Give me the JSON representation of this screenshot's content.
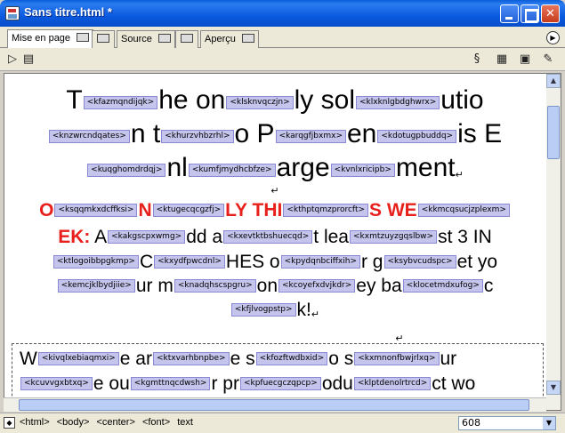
{
  "window": {
    "title": "Sans titre.html *"
  },
  "tabs": [
    {
      "label": "Mise en page",
      "active": true
    },
    {
      "label": ""
    },
    {
      "label": "Source"
    },
    {
      "label": ""
    },
    {
      "label": "Aperçu"
    }
  ],
  "toolbar": {
    "left_icons": [
      "play-arrow-icon",
      "document-icon"
    ],
    "right_icons": [
      "link-icon",
      "table-icon",
      "image-icon",
      "settings-icon"
    ]
  },
  "document": {
    "line1": {
      "t1": "T",
      "tag1": "<kfazmqndijqk>",
      "t2": "he on",
      "tag2": "<klsknvqczjn>",
      "t3": "ly sol",
      "tag3": "<klxknlgbdghwrx>",
      "t4": "utio"
    },
    "line2": {
      "tag1": "<knzwrcndqates>",
      "t1": "n t",
      "tag2": "<khurzvhbzrhl>",
      "t2": "o P",
      "tag3": "<karqgfjbxmx>",
      "t3": "en",
      "tag4": "<kdotugpbuddq>",
      "t4": "is E"
    },
    "line3": {
      "tag1": "<kuqghomdrdqj>",
      "t1": "nl",
      "tag2": "<kumfjmydhcbfze>",
      "t2": "arge",
      "tag3": "<kvnlxricipb>",
      "t3": "ment",
      "marker": "↵"
    },
    "marker2": "↵",
    "line4": {
      "t1": "O",
      "tag1": "<ksqqmkxdcffksi>",
      "t2": "N",
      "tag2": "<ktugecqcgzfj>",
      "t3": "LY THI",
      "tag3": "<kthptqmzprorcft>",
      "t4": "S WE",
      "tag4": "<kkmcqsucjzplexm>"
    },
    "line5": {
      "t1": "EK:",
      "t2": "A",
      "tag1": "<kakgscpxwmg>",
      "t3": "dd a",
      "tag2": "<kxevtktbshuecqd>",
      "t4": "t lea",
      "tag3": "<kxmtzuyzgqslbw>",
      "t5": "st 3 IN"
    },
    "line6": {
      "tag1": "<ktlogoibbpgkmp>",
      "t1": "C",
      "tag2": "<kxydfpwcdnl>",
      "t2": "HES o",
      "tag3": "<kpydqnbciffxih>",
      "t3": "r g",
      "tag4": "<ksybvcudspc>",
      "t4": "et yo"
    },
    "line7": {
      "tag1": "<kemcjklbydjiie>",
      "t1": "ur m",
      "tag2": "<knadqhscspgru>",
      "t2": "on",
      "tag3": "<kcoyefxdvjkdr>",
      "t3": "ey ba",
      "tag4": "<klocetmdxufog>",
      "t4": "c"
    },
    "line8": {
      "tag1": "<kfjlvogpstp>",
      "t1": "k!",
      "marker": "↵"
    },
    "marker3": "↵",
    "box": {
      "line1": {
        "t1": "W",
        "tag1": "<kivqlxebiaqmxi>",
        "t2": "e ar",
        "tag2": "<ktxvarhbnpbe>",
        "t3": "e s",
        "tag3": "<kfozftwdbxid>",
        "t4": "o s",
        "tag4": "<kxmnonfbwjrlxq>",
        "t5": "ur"
      },
      "line2": {
        "tag1": "<kcuvvgxbtxq>",
        "t1": "e ou",
        "tag2": "<kgmttnqcdwsh>",
        "t2": "r pr",
        "tag3": "<kpfuecgczqpcp>",
        "t3": "odu",
        "tag4": "<klptdenolrtrcd>",
        "t4": "ct wo"
      }
    }
  },
  "statusbar": {
    "tags": [
      "<html>",
      "<body>",
      "<center>",
      "<font>",
      "text"
    ],
    "window_size": "608"
  }
}
